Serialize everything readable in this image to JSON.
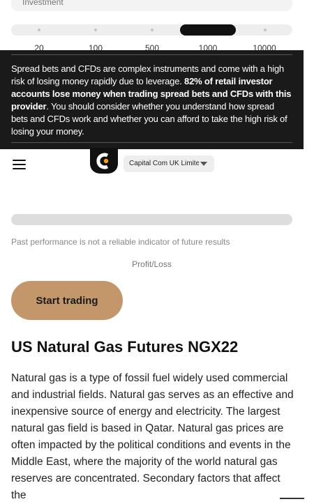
{
  "calculator": {
    "investment_label": "Investment",
    "slider_ticks": [
      "20",
      "100",
      "500",
      "1000",
      "10000"
    ],
    "result_disclaimer": "Past performance is not a reliable indicator of future results",
    "profit_loss_label": "Profit/Loss"
  },
  "risk_warning": {
    "text_part1": "Spread bets and CFDs are complex instruments and come with a high risk of losing money rapidly due to leverage. ",
    "text_bold": "82% of retail investor accounts lose money when trading spread bets and CFDs with this provider",
    "text_part2": ". You should consider whether you understand how spread bets and CFDs work and whether you can afford to take the high risk of losing your money."
  },
  "header": {
    "menu_icon": "hamburger-menu-icon",
    "logo_icon": "capital-com-logo",
    "entity_selector": "Capital Com UK Limited",
    "entity_dropdown_icon": "triangle-down-icon"
  },
  "cta": {
    "start_trading_label": "Start trading"
  },
  "article": {
    "title": "US Natural Gas Futures NGX22",
    "body": "Natural gas is a type of fossil fuel widely used commercial and industrial fields. Natural gas serves as an effective and inexpensive source of energy and electricity. The largest natural gas field is based in Qatar. Natural gas prices are often impacted by the political conditions and events in the Middle East, where the majority of the world natural gas reserves are concentrated. Secondary factors that affect the"
  },
  "colors": {
    "accent": "#c4976b",
    "banner_background": "#1a1a1a"
  }
}
